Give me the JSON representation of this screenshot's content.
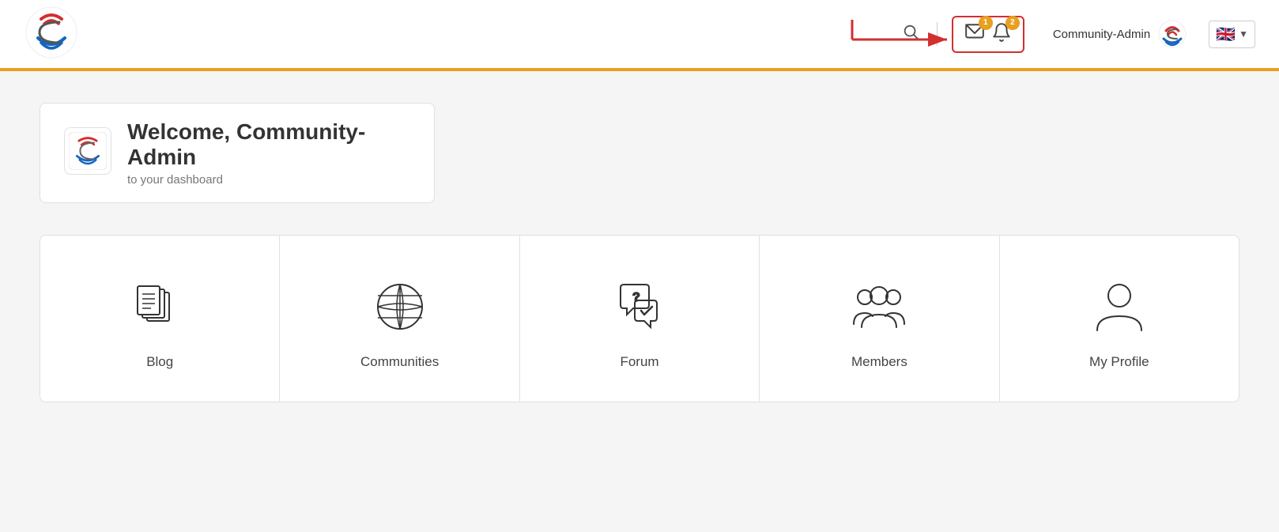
{
  "header": {
    "logo_alt": "Community Logo",
    "search_label": "Search",
    "messages_count": "1",
    "notifications_count": "2",
    "username": "Community-Admin",
    "language": "EN",
    "lang_flag": "🇬🇧"
  },
  "welcome": {
    "greeting": "Welcome, ",
    "username": "Community-Admin",
    "subtitle": "to your dashboard",
    "logo_alt": "Community Logo"
  },
  "dashboard_cards": [
    {
      "id": "blog",
      "label": "Blog",
      "icon": "blog"
    },
    {
      "id": "communities",
      "label": "Communities",
      "icon": "globe"
    },
    {
      "id": "forum",
      "label": "Forum",
      "icon": "forum"
    },
    {
      "id": "members",
      "label": "Members",
      "icon": "members"
    },
    {
      "id": "my-profile",
      "label": "My Profile",
      "icon": "profile"
    }
  ]
}
